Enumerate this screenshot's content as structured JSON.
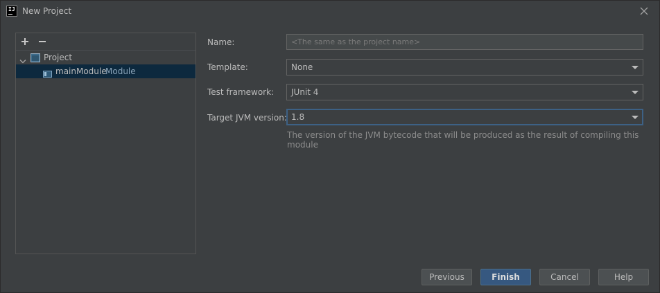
{
  "window": {
    "title": "New Project",
    "app_icon_text": "IJ"
  },
  "tree": {
    "project_label": "Project",
    "module_name": "mainModule",
    "module_type": "Module"
  },
  "form": {
    "name_label": "Name:",
    "name_placeholder": "<The same as the project name>",
    "name_value": "",
    "template_label": "Template:",
    "template_value": "None",
    "test_framework_label": "Test framework:",
    "test_framework_value": "JUnit 4",
    "jvm_label": "Target JVM version:",
    "jvm_value": "1.8",
    "jvm_hint": "The version of the JVM bytecode that will be produced as the result of compiling this module"
  },
  "buttons": {
    "previous": "Previous",
    "finish": "Finish",
    "cancel": "Cancel",
    "help": "Help"
  },
  "colors": {
    "background": "#3c3f41",
    "selection": "#0d293e",
    "primary_button": "#365880",
    "focus_border": "#3d6185"
  },
  "icons": {
    "add": "plus-icon",
    "remove": "minus-icon",
    "close": "close-icon",
    "expand": "chevron-down-icon",
    "project": "project-icon",
    "module": "module-icon"
  }
}
